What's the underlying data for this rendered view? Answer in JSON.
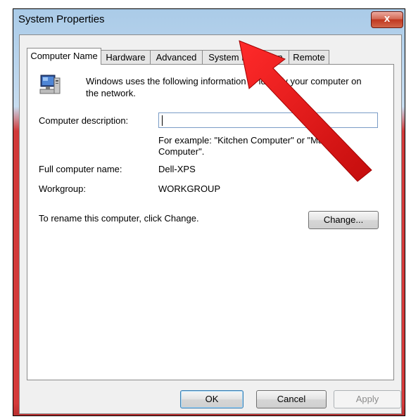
{
  "window": {
    "title": "System Properties",
    "close_label": "x"
  },
  "tabs": [
    {
      "label": "Computer Name",
      "active": true
    },
    {
      "label": "Hardware",
      "active": false
    },
    {
      "label": "Advanced",
      "active": false
    },
    {
      "label": "System Protection",
      "active": false
    },
    {
      "label": "Remote",
      "active": false
    }
  ],
  "panel": {
    "intro_line1": "Windows uses the following information to identify your computer on",
    "intro_line2": "the network.",
    "description_label": "Computer description:",
    "description_value": "",
    "example_line1": "For example: \"Kitchen Computer\" or \"Mary's",
    "example_line2": "Computer\".",
    "full_name_label": "Full computer name:",
    "full_name_value": "Dell-XPS",
    "workgroup_label": "Workgroup:",
    "workgroup_value": "WORKGROUP",
    "rename_text": "To rename this computer, click Change.",
    "change_button": "Change..."
  },
  "footer": {
    "ok": "OK",
    "cancel": "Cancel",
    "apply": "Apply"
  },
  "icons": {
    "computer": "computer-icon",
    "close": "close-icon",
    "annotation": "red-arrow-icon"
  },
  "colors": {
    "frame_top": "#aacbe8",
    "frame_red": "#d43a3a",
    "arrow": "#e01818",
    "close_button": "#c03820"
  }
}
